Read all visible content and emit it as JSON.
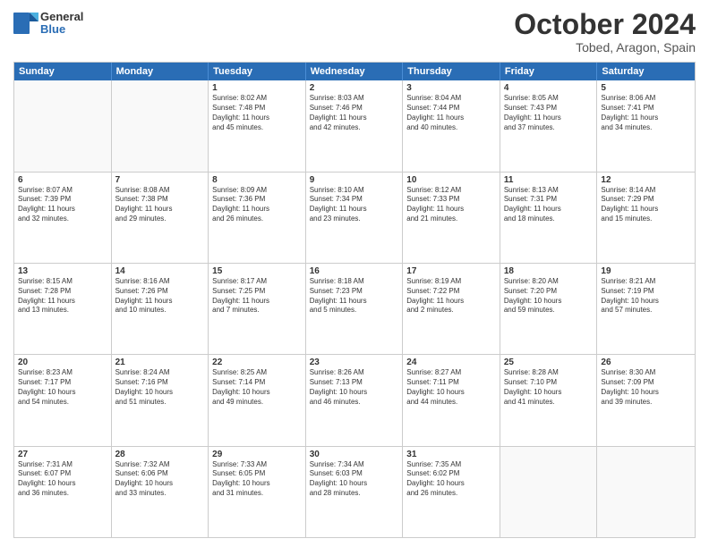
{
  "header": {
    "logo": {
      "general": "General",
      "blue": "Blue"
    },
    "month": "October 2024",
    "location": "Tobed, Aragon, Spain"
  },
  "weekdays": [
    "Sunday",
    "Monday",
    "Tuesday",
    "Wednesday",
    "Thursday",
    "Friday",
    "Saturday"
  ],
  "rows": [
    [
      {
        "day": "",
        "empty": true
      },
      {
        "day": "",
        "empty": true
      },
      {
        "day": "1",
        "lines": [
          "Sunrise: 8:02 AM",
          "Sunset: 7:48 PM",
          "Daylight: 11 hours",
          "and 45 minutes."
        ]
      },
      {
        "day": "2",
        "lines": [
          "Sunrise: 8:03 AM",
          "Sunset: 7:46 PM",
          "Daylight: 11 hours",
          "and 42 minutes."
        ]
      },
      {
        "day": "3",
        "lines": [
          "Sunrise: 8:04 AM",
          "Sunset: 7:44 PM",
          "Daylight: 11 hours",
          "and 40 minutes."
        ]
      },
      {
        "day": "4",
        "lines": [
          "Sunrise: 8:05 AM",
          "Sunset: 7:43 PM",
          "Daylight: 11 hours",
          "and 37 minutes."
        ]
      },
      {
        "day": "5",
        "lines": [
          "Sunrise: 8:06 AM",
          "Sunset: 7:41 PM",
          "Daylight: 11 hours",
          "and 34 minutes."
        ]
      }
    ],
    [
      {
        "day": "6",
        "lines": [
          "Sunrise: 8:07 AM",
          "Sunset: 7:39 PM",
          "Daylight: 11 hours",
          "and 32 minutes."
        ]
      },
      {
        "day": "7",
        "lines": [
          "Sunrise: 8:08 AM",
          "Sunset: 7:38 PM",
          "Daylight: 11 hours",
          "and 29 minutes."
        ]
      },
      {
        "day": "8",
        "lines": [
          "Sunrise: 8:09 AM",
          "Sunset: 7:36 PM",
          "Daylight: 11 hours",
          "and 26 minutes."
        ]
      },
      {
        "day": "9",
        "lines": [
          "Sunrise: 8:10 AM",
          "Sunset: 7:34 PM",
          "Daylight: 11 hours",
          "and 23 minutes."
        ]
      },
      {
        "day": "10",
        "lines": [
          "Sunrise: 8:12 AM",
          "Sunset: 7:33 PM",
          "Daylight: 11 hours",
          "and 21 minutes."
        ]
      },
      {
        "day": "11",
        "lines": [
          "Sunrise: 8:13 AM",
          "Sunset: 7:31 PM",
          "Daylight: 11 hours",
          "and 18 minutes."
        ]
      },
      {
        "day": "12",
        "lines": [
          "Sunrise: 8:14 AM",
          "Sunset: 7:29 PM",
          "Daylight: 11 hours",
          "and 15 minutes."
        ]
      }
    ],
    [
      {
        "day": "13",
        "lines": [
          "Sunrise: 8:15 AM",
          "Sunset: 7:28 PM",
          "Daylight: 11 hours",
          "and 13 minutes."
        ]
      },
      {
        "day": "14",
        "lines": [
          "Sunrise: 8:16 AM",
          "Sunset: 7:26 PM",
          "Daylight: 11 hours",
          "and 10 minutes."
        ]
      },
      {
        "day": "15",
        "lines": [
          "Sunrise: 8:17 AM",
          "Sunset: 7:25 PM",
          "Daylight: 11 hours",
          "and 7 minutes."
        ]
      },
      {
        "day": "16",
        "lines": [
          "Sunrise: 8:18 AM",
          "Sunset: 7:23 PM",
          "Daylight: 11 hours",
          "and 5 minutes."
        ]
      },
      {
        "day": "17",
        "lines": [
          "Sunrise: 8:19 AM",
          "Sunset: 7:22 PM",
          "Daylight: 11 hours",
          "and 2 minutes."
        ]
      },
      {
        "day": "18",
        "lines": [
          "Sunrise: 8:20 AM",
          "Sunset: 7:20 PM",
          "Daylight: 10 hours",
          "and 59 minutes."
        ]
      },
      {
        "day": "19",
        "lines": [
          "Sunrise: 8:21 AM",
          "Sunset: 7:19 PM",
          "Daylight: 10 hours",
          "and 57 minutes."
        ]
      }
    ],
    [
      {
        "day": "20",
        "lines": [
          "Sunrise: 8:23 AM",
          "Sunset: 7:17 PM",
          "Daylight: 10 hours",
          "and 54 minutes."
        ]
      },
      {
        "day": "21",
        "lines": [
          "Sunrise: 8:24 AM",
          "Sunset: 7:16 PM",
          "Daylight: 10 hours",
          "and 51 minutes."
        ]
      },
      {
        "day": "22",
        "lines": [
          "Sunrise: 8:25 AM",
          "Sunset: 7:14 PM",
          "Daylight: 10 hours",
          "and 49 minutes."
        ]
      },
      {
        "day": "23",
        "lines": [
          "Sunrise: 8:26 AM",
          "Sunset: 7:13 PM",
          "Daylight: 10 hours",
          "and 46 minutes."
        ]
      },
      {
        "day": "24",
        "lines": [
          "Sunrise: 8:27 AM",
          "Sunset: 7:11 PM",
          "Daylight: 10 hours",
          "and 44 minutes."
        ]
      },
      {
        "day": "25",
        "lines": [
          "Sunrise: 8:28 AM",
          "Sunset: 7:10 PM",
          "Daylight: 10 hours",
          "and 41 minutes."
        ]
      },
      {
        "day": "26",
        "lines": [
          "Sunrise: 8:30 AM",
          "Sunset: 7:09 PM",
          "Daylight: 10 hours",
          "and 39 minutes."
        ]
      }
    ],
    [
      {
        "day": "27",
        "lines": [
          "Sunrise: 7:31 AM",
          "Sunset: 6:07 PM",
          "Daylight: 10 hours",
          "and 36 minutes."
        ]
      },
      {
        "day": "28",
        "lines": [
          "Sunrise: 7:32 AM",
          "Sunset: 6:06 PM",
          "Daylight: 10 hours",
          "and 33 minutes."
        ]
      },
      {
        "day": "29",
        "lines": [
          "Sunrise: 7:33 AM",
          "Sunset: 6:05 PM",
          "Daylight: 10 hours",
          "and 31 minutes."
        ]
      },
      {
        "day": "30",
        "lines": [
          "Sunrise: 7:34 AM",
          "Sunset: 6:03 PM",
          "Daylight: 10 hours",
          "and 28 minutes."
        ]
      },
      {
        "day": "31",
        "lines": [
          "Sunrise: 7:35 AM",
          "Sunset: 6:02 PM",
          "Daylight: 10 hours",
          "and 26 minutes."
        ]
      },
      {
        "day": "",
        "empty": true
      },
      {
        "day": "",
        "empty": true
      }
    ]
  ]
}
